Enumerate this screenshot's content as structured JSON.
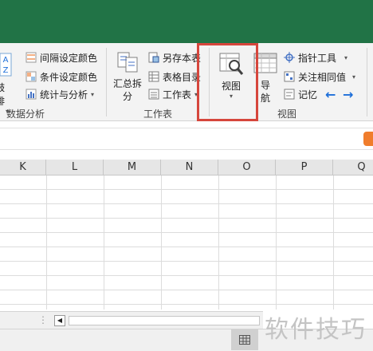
{
  "ribbon": {
    "cut_left_big_label": "鼓排",
    "az_icon_text": "A\nZ",
    "data_analysis": {
      "items": [
        "间隔设定颜色",
        "条件设定颜色",
        "统计与分析"
      ],
      "label": "数据分析"
    },
    "worksheet": {
      "summary_label": "汇总拆\n分",
      "items": [
        "另存本表",
        "表格目录",
        "工作表"
      ],
      "label": "工作表"
    },
    "view": {
      "view_label": "视图",
      "nav_label": "导\n航",
      "items": [
        "指针工具",
        "关注相同值",
        "记忆"
      ],
      "label": "视图"
    }
  },
  "sheet": {
    "columns": [
      "K",
      "L",
      "M",
      "N",
      "O",
      "P",
      "Q"
    ]
  },
  "watermark": "软件技巧",
  "colors": {
    "titlebar": "#217346",
    "highlight": "#d6463c",
    "arrow": "#1e6fd9"
  }
}
